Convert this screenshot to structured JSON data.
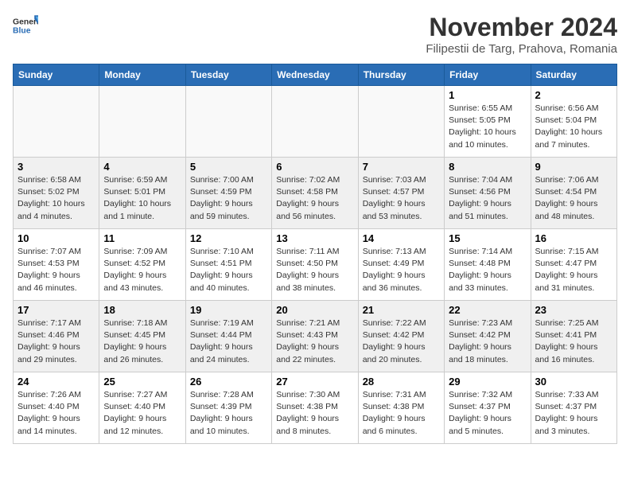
{
  "header": {
    "logo_general": "General",
    "logo_blue": "Blue",
    "month_year": "November 2024",
    "location": "Filipestii de Targ, Prahova, Romania"
  },
  "days_of_week": [
    "Sunday",
    "Monday",
    "Tuesday",
    "Wednesday",
    "Thursday",
    "Friday",
    "Saturday"
  ],
  "weeks": [
    [
      {
        "day": "",
        "info": ""
      },
      {
        "day": "",
        "info": ""
      },
      {
        "day": "",
        "info": ""
      },
      {
        "day": "",
        "info": ""
      },
      {
        "day": "",
        "info": ""
      },
      {
        "day": "1",
        "info": "Sunrise: 6:55 AM\nSunset: 5:05 PM\nDaylight: 10 hours and 10 minutes."
      },
      {
        "day": "2",
        "info": "Sunrise: 6:56 AM\nSunset: 5:04 PM\nDaylight: 10 hours and 7 minutes."
      }
    ],
    [
      {
        "day": "3",
        "info": "Sunrise: 6:58 AM\nSunset: 5:02 PM\nDaylight: 10 hours and 4 minutes."
      },
      {
        "day": "4",
        "info": "Sunrise: 6:59 AM\nSunset: 5:01 PM\nDaylight: 10 hours and 1 minute."
      },
      {
        "day": "5",
        "info": "Sunrise: 7:00 AM\nSunset: 4:59 PM\nDaylight: 9 hours and 59 minutes."
      },
      {
        "day": "6",
        "info": "Sunrise: 7:02 AM\nSunset: 4:58 PM\nDaylight: 9 hours and 56 minutes."
      },
      {
        "day": "7",
        "info": "Sunrise: 7:03 AM\nSunset: 4:57 PM\nDaylight: 9 hours and 53 minutes."
      },
      {
        "day": "8",
        "info": "Sunrise: 7:04 AM\nSunset: 4:56 PM\nDaylight: 9 hours and 51 minutes."
      },
      {
        "day": "9",
        "info": "Sunrise: 7:06 AM\nSunset: 4:54 PM\nDaylight: 9 hours and 48 minutes."
      }
    ],
    [
      {
        "day": "10",
        "info": "Sunrise: 7:07 AM\nSunset: 4:53 PM\nDaylight: 9 hours and 46 minutes."
      },
      {
        "day": "11",
        "info": "Sunrise: 7:09 AM\nSunset: 4:52 PM\nDaylight: 9 hours and 43 minutes."
      },
      {
        "day": "12",
        "info": "Sunrise: 7:10 AM\nSunset: 4:51 PM\nDaylight: 9 hours and 40 minutes."
      },
      {
        "day": "13",
        "info": "Sunrise: 7:11 AM\nSunset: 4:50 PM\nDaylight: 9 hours and 38 minutes."
      },
      {
        "day": "14",
        "info": "Sunrise: 7:13 AM\nSunset: 4:49 PM\nDaylight: 9 hours and 36 minutes."
      },
      {
        "day": "15",
        "info": "Sunrise: 7:14 AM\nSunset: 4:48 PM\nDaylight: 9 hours and 33 minutes."
      },
      {
        "day": "16",
        "info": "Sunrise: 7:15 AM\nSunset: 4:47 PM\nDaylight: 9 hours and 31 minutes."
      }
    ],
    [
      {
        "day": "17",
        "info": "Sunrise: 7:17 AM\nSunset: 4:46 PM\nDaylight: 9 hours and 29 minutes."
      },
      {
        "day": "18",
        "info": "Sunrise: 7:18 AM\nSunset: 4:45 PM\nDaylight: 9 hours and 26 minutes."
      },
      {
        "day": "19",
        "info": "Sunrise: 7:19 AM\nSunset: 4:44 PM\nDaylight: 9 hours and 24 minutes."
      },
      {
        "day": "20",
        "info": "Sunrise: 7:21 AM\nSunset: 4:43 PM\nDaylight: 9 hours and 22 minutes."
      },
      {
        "day": "21",
        "info": "Sunrise: 7:22 AM\nSunset: 4:42 PM\nDaylight: 9 hours and 20 minutes."
      },
      {
        "day": "22",
        "info": "Sunrise: 7:23 AM\nSunset: 4:42 PM\nDaylight: 9 hours and 18 minutes."
      },
      {
        "day": "23",
        "info": "Sunrise: 7:25 AM\nSunset: 4:41 PM\nDaylight: 9 hours and 16 minutes."
      }
    ],
    [
      {
        "day": "24",
        "info": "Sunrise: 7:26 AM\nSunset: 4:40 PM\nDaylight: 9 hours and 14 minutes."
      },
      {
        "day": "25",
        "info": "Sunrise: 7:27 AM\nSunset: 4:40 PM\nDaylight: 9 hours and 12 minutes."
      },
      {
        "day": "26",
        "info": "Sunrise: 7:28 AM\nSunset: 4:39 PM\nDaylight: 9 hours and 10 minutes."
      },
      {
        "day": "27",
        "info": "Sunrise: 7:30 AM\nSunset: 4:38 PM\nDaylight: 9 hours and 8 minutes."
      },
      {
        "day": "28",
        "info": "Sunrise: 7:31 AM\nSunset: 4:38 PM\nDaylight: 9 hours and 6 minutes."
      },
      {
        "day": "29",
        "info": "Sunrise: 7:32 AM\nSunset: 4:37 PM\nDaylight: 9 hours and 5 minutes."
      },
      {
        "day": "30",
        "info": "Sunrise: 7:33 AM\nSunset: 4:37 PM\nDaylight: 9 hours and 3 minutes."
      }
    ]
  ]
}
